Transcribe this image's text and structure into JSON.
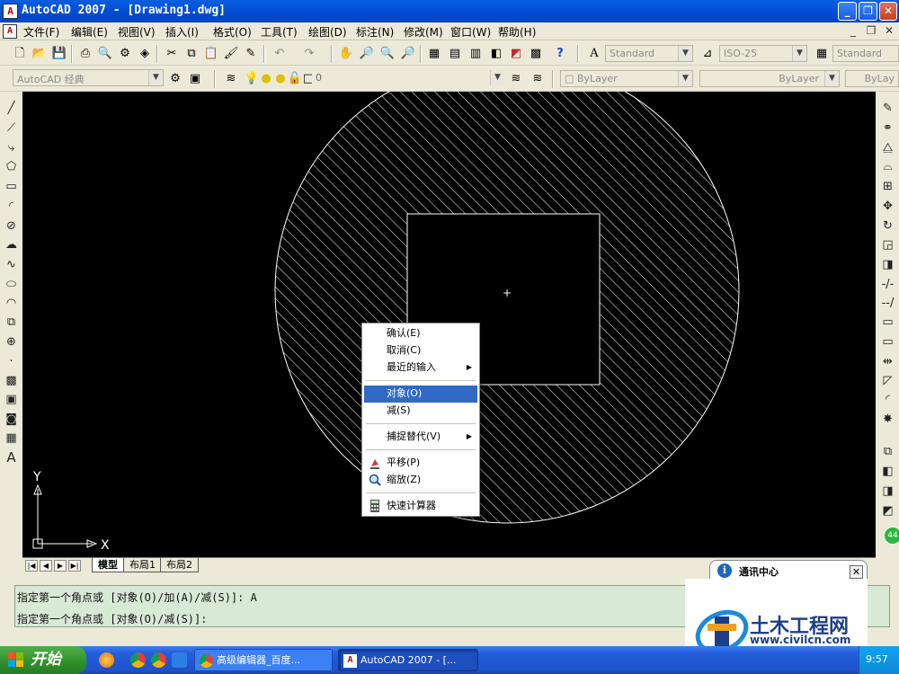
{
  "window": {
    "title": "AutoCAD 2007 - [Drawing1.dwg]",
    "app_icon_glyph": "A",
    "doc_icon_glyph": "A"
  },
  "menu": [
    {
      "label": "文件(F)"
    },
    {
      "label": "编辑(E)"
    },
    {
      "label": "视图(V)"
    },
    {
      "label": "插入(I)"
    },
    {
      "label": "格式(O)"
    },
    {
      "label": "工具(T)"
    },
    {
      "label": "绘图(D)"
    },
    {
      "label": "标注(N)"
    },
    {
      "label": "修改(M)"
    },
    {
      "label": "窗口(W)"
    },
    {
      "label": "帮助(H)"
    }
  ],
  "toolbar": {
    "text_style": "Standard",
    "dim_style": "ISO-25",
    "table_style": "Standard",
    "workspace": "AutoCAD 经典",
    "layer": "0",
    "color": "ByLayer",
    "linetype": "ByLayer",
    "lineweight": "ByLay"
  },
  "drawing": {
    "crosshair": "+",
    "ucs_y": "Y",
    "ucs_x": "X"
  },
  "layout_tabs": [
    {
      "label": "模型",
      "active": true
    },
    {
      "label": "布局1",
      "active": false
    },
    {
      "label": "布局2",
      "active": false
    }
  ],
  "context_menu": {
    "items": [
      {
        "label": "确认(E)",
        "highlight": false,
        "submenu": false,
        "icon": ""
      },
      {
        "label": "取消(C)",
        "highlight": false,
        "submenu": false,
        "icon": ""
      },
      {
        "label": "最近的输入",
        "highlight": false,
        "submenu": true,
        "icon": ""
      },
      {
        "label": "对象(O)",
        "highlight": true,
        "submenu": false,
        "icon": ""
      },
      {
        "label": "减(S)",
        "highlight": false,
        "submenu": false,
        "icon": ""
      },
      {
        "label": "捕捉替代(V)",
        "highlight": false,
        "submenu": true,
        "icon": ""
      },
      {
        "label": "平移(P)",
        "highlight": false,
        "submenu": false,
        "icon": "pan-icon"
      },
      {
        "label": "缩放(Z)",
        "highlight": false,
        "submenu": false,
        "icon": "zoom-icon"
      },
      {
        "label": "快速计算器",
        "highlight": false,
        "submenu": false,
        "icon": "calculator-icon"
      }
    ],
    "submenu_glyph": "▶"
  },
  "command": {
    "line1": "指定第一个角点或 [对象(O)/加(A)/减(S)]: A",
    "line2": "指定第一个角点或 [对象(O)/减(S)]:"
  },
  "comm_center": {
    "title": "通讯中心",
    "close": "✕"
  },
  "watermark": {
    "name": "土木工程网",
    "url": "www.civilcn.com"
  },
  "taskbar": {
    "start": "开始",
    "tasks": [
      {
        "label": "高级编辑器_百度...",
        "active": false
      },
      {
        "label": "AutoCAD 2007 - [...",
        "active": true
      }
    ],
    "clock": "9:57",
    "badge": "44"
  },
  "colors": {
    "hatch": "#ffffff",
    "canvas": "#000000",
    "highlight": "#316ac5",
    "cmd_bg": "#d8ead6"
  }
}
